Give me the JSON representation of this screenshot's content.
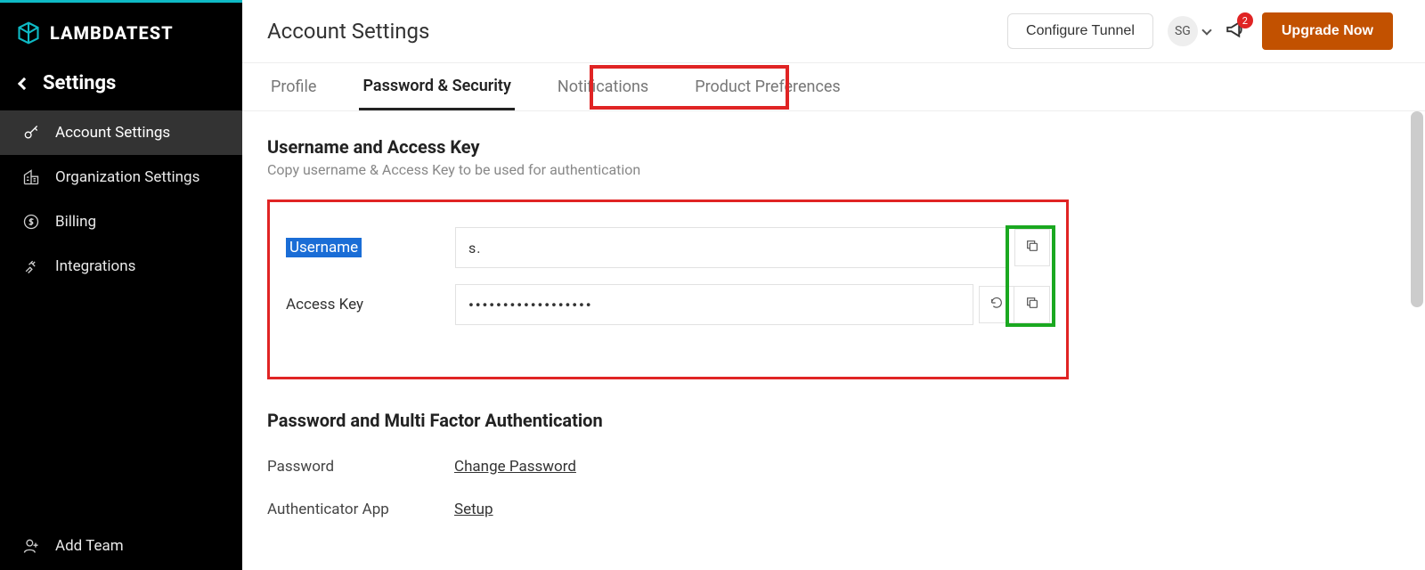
{
  "brand": {
    "name": "LAMBDATEST"
  },
  "sidebar": {
    "back_label": "Settings",
    "items": [
      {
        "label": "Account Settings"
      },
      {
        "label": "Organization Settings"
      },
      {
        "label": "Billing"
      },
      {
        "label": "Integrations"
      }
    ],
    "add_team_label": "Add Team"
  },
  "header": {
    "title": "Account Settings",
    "configure_tunnel_label": "Configure Tunnel",
    "avatar_initials": "SG",
    "notification_count": "2",
    "upgrade_label": "Upgrade Now"
  },
  "tabs": [
    {
      "label": "Profile"
    },
    {
      "label": "Password & Security"
    },
    {
      "label": "Notifications"
    },
    {
      "label": "Product Preferences"
    }
  ],
  "credentials": {
    "section_title": "Username and Access Key",
    "section_subtitle": "Copy username & Access Key to be used for authentication",
    "username_label": "Username",
    "username_value": "s.",
    "accesskey_label": "Access Key",
    "accesskey_value": "••••••••••••••••••"
  },
  "auth": {
    "section_title": "Password and Multi Factor Authentication",
    "password_label": "Password",
    "change_password_link": "Change Password",
    "authenticator_label": "Authenticator App",
    "setup_link": "Setup"
  }
}
